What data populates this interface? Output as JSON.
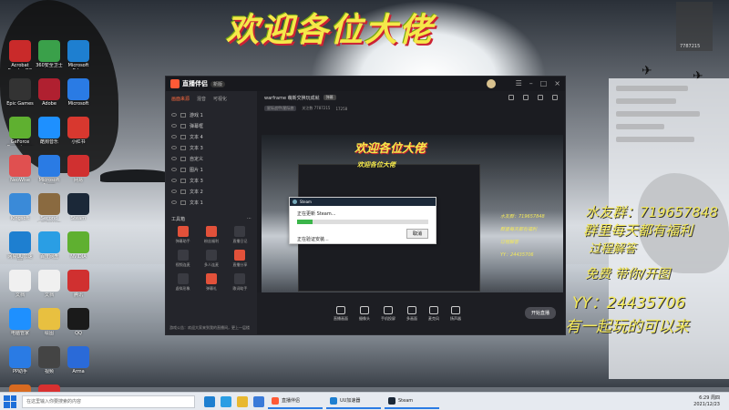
{
  "overlay": {
    "title": "欢迎各位大佬",
    "lines": [
      "水友群：719657848",
      "群里每天都有福利",
      "过程解答",
      "免费 带你/开图",
      "YY：24435706",
      "有一起玩的可以来"
    ],
    "top_right_number": "7787215"
  },
  "desktop_icons": [
    {
      "label": "Acrobat Reader DC",
      "color": "#c92a2a"
    },
    {
      "label": "360安全卫士",
      "color": "#3aa04a"
    },
    {
      "label": "Microsoft Edge",
      "color": "#1e7fd0"
    },
    {
      "label": "Epic Games",
      "color": "#333333"
    },
    {
      "label": "Adobe",
      "color": "#b02030"
    },
    {
      "label": "Microsoft",
      "color": "#2a7be4"
    },
    {
      "label": "GeForce Experience",
      "color": "#5fb030"
    },
    {
      "label": "酷狗音乐",
      "color": "#1e90ff"
    },
    {
      "label": "小红书",
      "color": "#d8382f"
    },
    {
      "label": "NeoWise",
      "color": "#e05050"
    },
    {
      "label": "Microsoft Store",
      "color": "#2a7be4"
    },
    {
      "label": "网易",
      "color": "#d03030"
    },
    {
      "label": "Kingsoft",
      "color": "#3a8ad8"
    },
    {
      "label": "Second Collective",
      "color": "#8a6a40"
    },
    {
      "label": "Steam",
      "color": "#1b2838"
    },
    {
      "label": "网易UU加速器",
      "color": "#1e7fd0"
    },
    {
      "label": "百度网盘",
      "color": "#2a9ee4"
    },
    {
      "label": "NVIDIA",
      "color": "#5fb030"
    },
    {
      "label": "文档",
      "color": "#f0f0f0"
    },
    {
      "label": "文档",
      "color": "#f0f0f0"
    },
    {
      "label": "腾讯",
      "color": "#d03030"
    },
    {
      "label": "电脑管家",
      "color": "#1e90ff"
    },
    {
      "label": "绘图",
      "color": "#e8c040"
    },
    {
      "label": "QQ",
      "color": "#1a1a1a"
    },
    {
      "label": "PP助手",
      "color": "#2a7be4"
    },
    {
      "label": "视频",
      "color": "#444444"
    },
    {
      "label": "Arma",
      "color": "#2a6ad8"
    },
    {
      "label": "Aim",
      "color": "#d86a20"
    },
    {
      "label": "Valorant",
      "color": "#d83030"
    }
  ],
  "app": {
    "name": "直播伴侣",
    "version": "新版",
    "sidebar_tabs": [
      "画面来源",
      "混音",
      "可视化"
    ],
    "sources": [
      "游戏 1",
      "弹幕框",
      "文本 4",
      "文本 3",
      "自定义",
      "图片 1",
      "文本 3",
      "文本 2",
      "文本 1"
    ],
    "tools_label": "工具箱",
    "tools": [
      {
        "label": "弹幕助手",
        "red": true
      },
      {
        "label": "粉丝福利",
        "red": true
      },
      {
        "label": "直播日记",
        "red": false
      },
      {
        "label": "视频连麦",
        "red": false
      },
      {
        "label": "多人连麦",
        "red": false
      },
      {
        "label": "直播分享",
        "red": true
      },
      {
        "label": "虚拟形象",
        "red": false
      },
      {
        "label": "弹幕礼",
        "red": true
      },
      {
        "label": "歌词助手",
        "red": false
      }
    ],
    "notice": "游戏公告：欢迎大家来到我的直播间，更上一层楼",
    "main_title": "warframe 萌新交换玩成就",
    "main_tag": "弹幕",
    "sub_badge": "星际战甲/星际旅",
    "sub_fans": "关注数 7787215",
    "sub_count": "17258",
    "preview": {
      "title": "欢迎各位大佬",
      "inner_title": "欢迎各位大佬"
    },
    "steam_dialog": {
      "title": "Steam",
      "message1": "正在更新 Steam...",
      "message2": "正在验证安装...",
      "cancel": "取消",
      "progress": 0.12
    },
    "bottom_tools": [
      "直播画面",
      "摄像头",
      "手机投屏",
      "多画面",
      "麦克风",
      "扬声器"
    ],
    "live_button": "开始直播"
  },
  "taskbar": {
    "search_placeholder": "在这里输入你要搜索的内容",
    "apps": [
      {
        "label": "直播伴侣",
        "color": "#ff5a36"
      },
      {
        "label": "UU加速器",
        "color": "#1e7fd0"
      },
      {
        "label": "Steam",
        "color": "#1b2838"
      }
    ],
    "time": "6:29 周四",
    "date": "2021/12/23"
  },
  "colors": {
    "accent": "#ff6a3e",
    "overlay_text": "#f3e85a"
  }
}
